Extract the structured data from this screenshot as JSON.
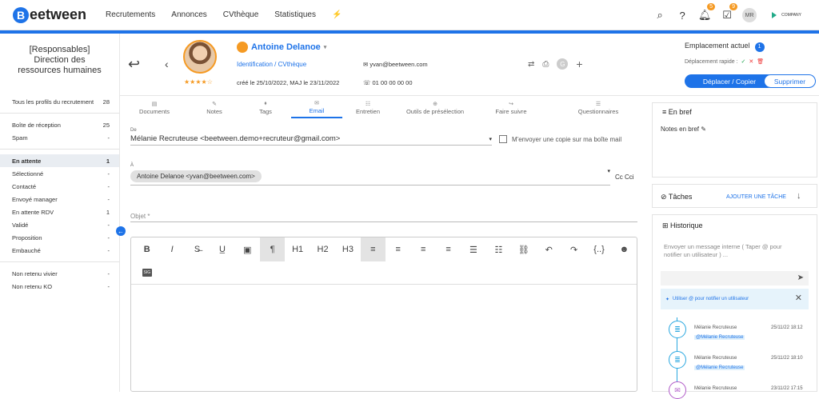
{
  "app": {
    "logo_letter": "B",
    "logo_text": "eetween",
    "brand_color": "#1e73e8"
  },
  "nav": [
    "Recrutements",
    "Annonces",
    "CVthèque",
    "Statistiques"
  ],
  "top": {
    "bell_count": "5",
    "tasks_count": "9",
    "avatar": "MR",
    "company": "COMPANY"
  },
  "sidebar": {
    "dept": "[Responsables] Direction des ressources humaines",
    "group1": [
      {
        "label": "Tous les profils du recrutement",
        "count": "28"
      }
    ],
    "group2": [
      {
        "label": "Boîte de réception",
        "count": "25"
      },
      {
        "label": "Spam",
        "count": "-"
      }
    ],
    "group3": [
      {
        "label": "En attente",
        "count": "1"
      },
      {
        "label": "Sélectionné",
        "count": "-"
      },
      {
        "label": "Contacté",
        "count": "-"
      },
      {
        "label": "Envoyé manager",
        "count": "-"
      },
      {
        "label": "En attente RDV",
        "count": "1"
      },
      {
        "label": "Validé",
        "count": "-"
      },
      {
        "label": "Proposition",
        "count": "-"
      },
      {
        "label": "Embauché",
        "count": "-"
      }
    ],
    "group4": [
      {
        "label": "Non retenu vivier",
        "count": "-"
      },
      {
        "label": "Non retenu KO",
        "count": "-"
      }
    ]
  },
  "candidate": {
    "name": "Antoine Delanoe",
    "identification": "Identification / CVthèque",
    "created": "créé le 25/10/2022, MAJ le 23/11/2022",
    "email": "yvan@beetween.com",
    "phone": "01 00 00 00 00",
    "rating": 4
  },
  "location": {
    "title": "Emplacement actuel",
    "count": "1",
    "quick": "Déplacement rapide :",
    "move_btn": "Déplacer / Copier",
    "delete_btn": "Supprimer"
  },
  "tabs": [
    "Documents",
    "Notes",
    "Tags",
    "Email",
    "Entretien",
    "Outils de présélection",
    "Faire suivre",
    "Questionnaires"
  ],
  "active_tab": "Email",
  "form": {
    "from_label": "De",
    "from_value": "Mélanie Recruteuse <beetween.demo+recruteur@gmail.com>",
    "copy_label": "M'envoyer une copie sur ma boîte mail",
    "to_label": "À",
    "to_chip": "Antoine Delanoe <yvan@beetween.com>",
    "cc": "Cc Cci",
    "subject_placeholder": "Objet *"
  },
  "toolbar": [
    "B",
    "I",
    "S",
    "U",
    "img",
    "¶",
    "H1",
    "H2",
    "H3",
    "align-left",
    "align-center",
    "align-right",
    "justify",
    "list",
    "ordered-list",
    "link",
    "undo",
    "redo",
    "{..}",
    "emoji"
  ],
  "toolbar_row2": [
    "sig"
  ],
  "brief": {
    "title": "En bref",
    "notes": "Notes en bref"
  },
  "tasks": {
    "title": "Tâches",
    "add": "AJOUTER UNE TÂCHE"
  },
  "history": {
    "title": "Historique",
    "placeholder": "Envoyer un message interne ( Taper @ pour notifier un utilisateur ) ...",
    "hint": "Utiliser @ pour notifier un utilisateur",
    "items": [
      {
        "author": "Mélanie Recruteuse",
        "date": "25/11/22 18:12",
        "mention": "@Mélanie Recruteuse"
      },
      {
        "author": "Mélanie Recruteuse",
        "date": "25/11/22 18:10",
        "mention": "@Mélanie Recruteuse"
      },
      {
        "author": "Mélanie Recruteuse",
        "date": "23/11/22 17:15",
        "mention": ""
      }
    ]
  }
}
